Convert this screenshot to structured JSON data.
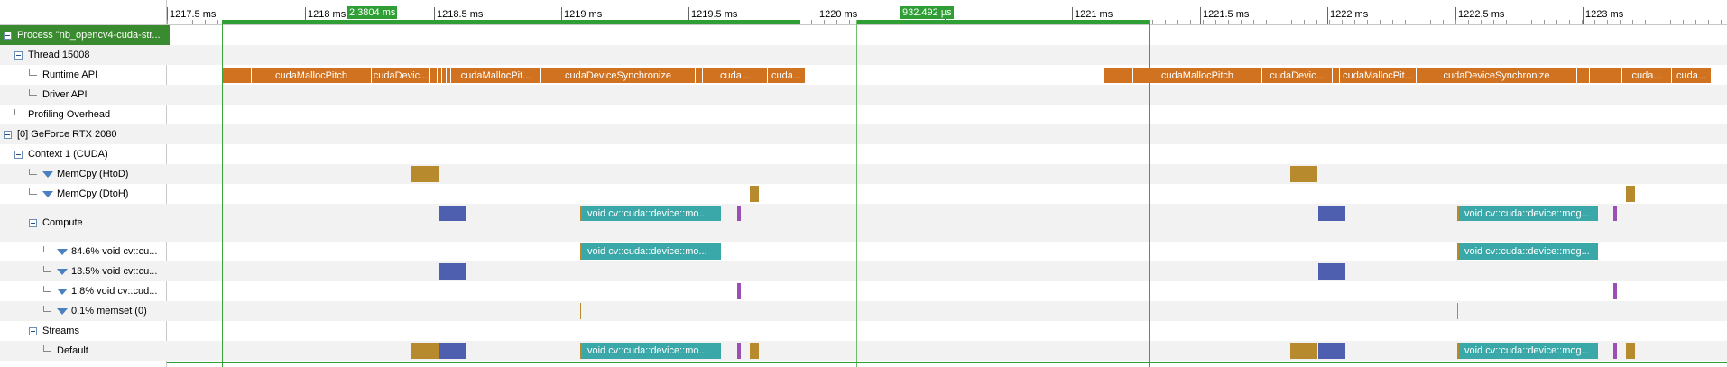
{
  "tree": [
    {
      "label": "Process \"nb_opencv4-cuda-str...",
      "kind": "toggle",
      "indent": 0,
      "selected": true
    },
    {
      "label": "Thread 15008",
      "kind": "toggle",
      "indent": 1
    },
    {
      "label": "Runtime API",
      "kind": "leaf",
      "indent": 2
    },
    {
      "label": "Driver API",
      "kind": "leaf",
      "indent": 2
    },
    {
      "label": "Profiling Overhead",
      "kind": "leaf",
      "indent": 1
    },
    {
      "label": "[0] GeForce RTX 2080",
      "kind": "toggle",
      "indent": 0
    },
    {
      "label": "Context 1 (CUDA)",
      "kind": "toggle",
      "indent": 1
    },
    {
      "label": "MemCpy (HtoD)",
      "kind": "filter",
      "indent": 2
    },
    {
      "label": "MemCpy (DtoH)",
      "kind": "filter",
      "indent": 2
    },
    {
      "label": "Compute",
      "kind": "toggle",
      "indent": 2,
      "tall": true
    },
    {
      "label": "84.6% void cv::cu...",
      "kind": "filter",
      "indent": 3
    },
    {
      "label": "13.5% void cv::cu...",
      "kind": "filter",
      "indent": 3
    },
    {
      "label": "1.8% void cv::cud...",
      "kind": "filter",
      "indent": 3
    },
    {
      "label": "0.1% memset (0)",
      "kind": "filter",
      "indent": 3
    },
    {
      "label": "Streams",
      "kind": "toggle",
      "indent": 2
    },
    {
      "label": "Default",
      "kind": "leaf",
      "indent": 3
    }
  ],
  "ruler": {
    "ticks": [
      "1217.5 ms",
      "1218 ms",
      "1218.5 ms",
      "1219 ms",
      "1219.5 ms",
      "1220 ms",
      "1220.5 ms",
      "1221 ms",
      "1221.5 ms",
      "1222 ms",
      "1222.5 ms",
      "1223 ms"
    ],
    "range1_label": "2.3804 ms",
    "range2_label": "932.492 µs"
  },
  "events": {
    "api_a": [
      "cudaMallocPitch",
      "cudaDevic...",
      "cudaMallocPit...",
      "cudaDeviceSynchronize",
      "cuda...",
      "cuda..."
    ],
    "api_b": [
      "cudaMallocPitch",
      "cudaDevic...",
      "cudaMallocPit...",
      "cudaDeviceSynchronize",
      "cuda...",
      "cuda..."
    ],
    "kernel_label": "void cv::cuda::device::mo...",
    "kernel_label_b": "void cv::cuda::device::mog...",
    "kernel_label_row": "void cv::cuda::device::mo...",
    "kernel_label_row_b": "void cv::cuda::device::mog..."
  },
  "colors": {
    "runtime_api": "#d0721f",
    "memcpy": "#b88a2e",
    "kernel_blue": "#4f5fb0",
    "kernel_teal": "#3aa8a8",
    "kernel_purple": "#9b4fb5",
    "selection_green": "#2e9e35"
  }
}
